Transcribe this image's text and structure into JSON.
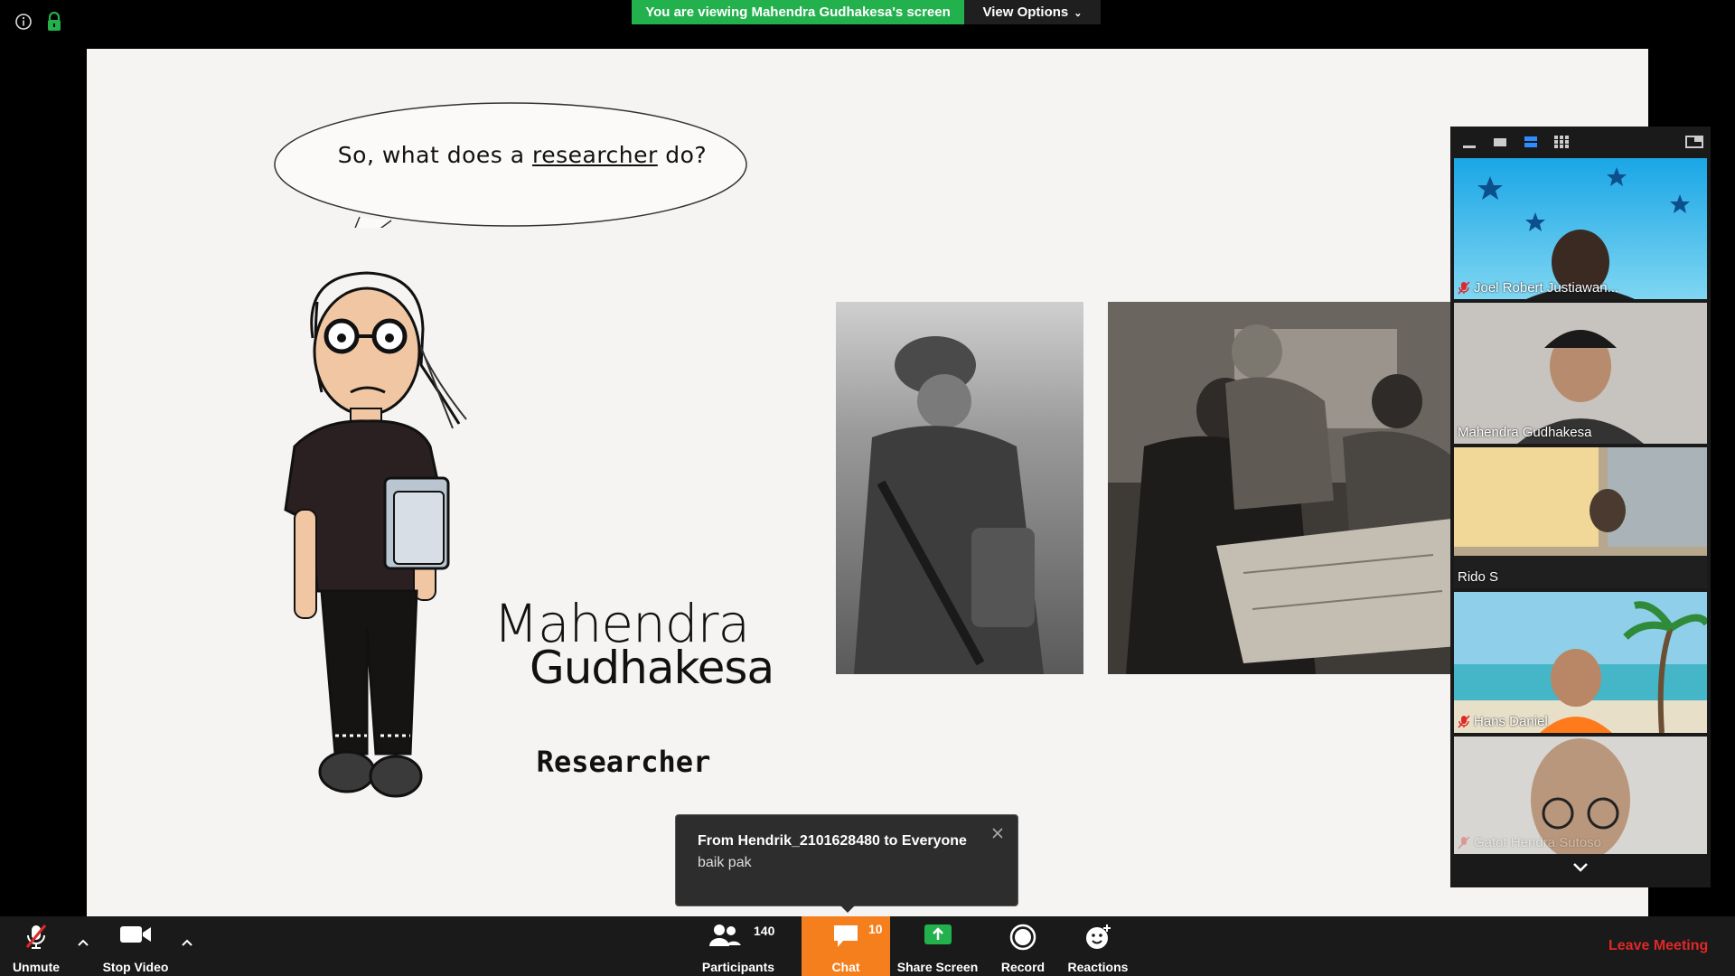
{
  "window": {
    "sharing_banner": "You are viewing Mahendra Gudhakesa's screen",
    "view_options_label": "View Options"
  },
  "slide": {
    "speech_bubble_prefix": "So, what does a ",
    "speech_bubble_underlined": "researcher",
    "speech_bubble_suffix": " do?",
    "name_line1": "Mahendra",
    "name_line2": "Gudhakesa",
    "role": "Researcher"
  },
  "gallery": {
    "participants": [
      {
        "name": "Joel Robert Justiawan...",
        "muted": true,
        "active": false
      },
      {
        "name": "Mahendra Gudhakesa",
        "muted": false,
        "active": true
      },
      {
        "name": "Rido S",
        "muted": false,
        "active": false
      },
      {
        "name": "Hans Daniel",
        "muted": true,
        "active": false
      },
      {
        "name": "Gatot Hendra Sutoso",
        "muted": true,
        "active": false
      }
    ]
  },
  "chat_toast": {
    "from": "From Hendrik_2101628480 to Everyone",
    "message": "baik pak"
  },
  "toolbar": {
    "unmute_label": "Unmute",
    "stop_video_label": "Stop Video",
    "participants_label": "Participants",
    "participants_count": "140",
    "chat_label": "Chat",
    "chat_count": "10",
    "share_screen_label": "Share Screen",
    "record_label": "Record",
    "reactions_label": "Reactions",
    "leave_label": "Leave Meeting"
  },
  "colors": {
    "accent_green": "#23b14d",
    "chat_orange": "#f67f1d",
    "leave_red": "#e02828"
  }
}
